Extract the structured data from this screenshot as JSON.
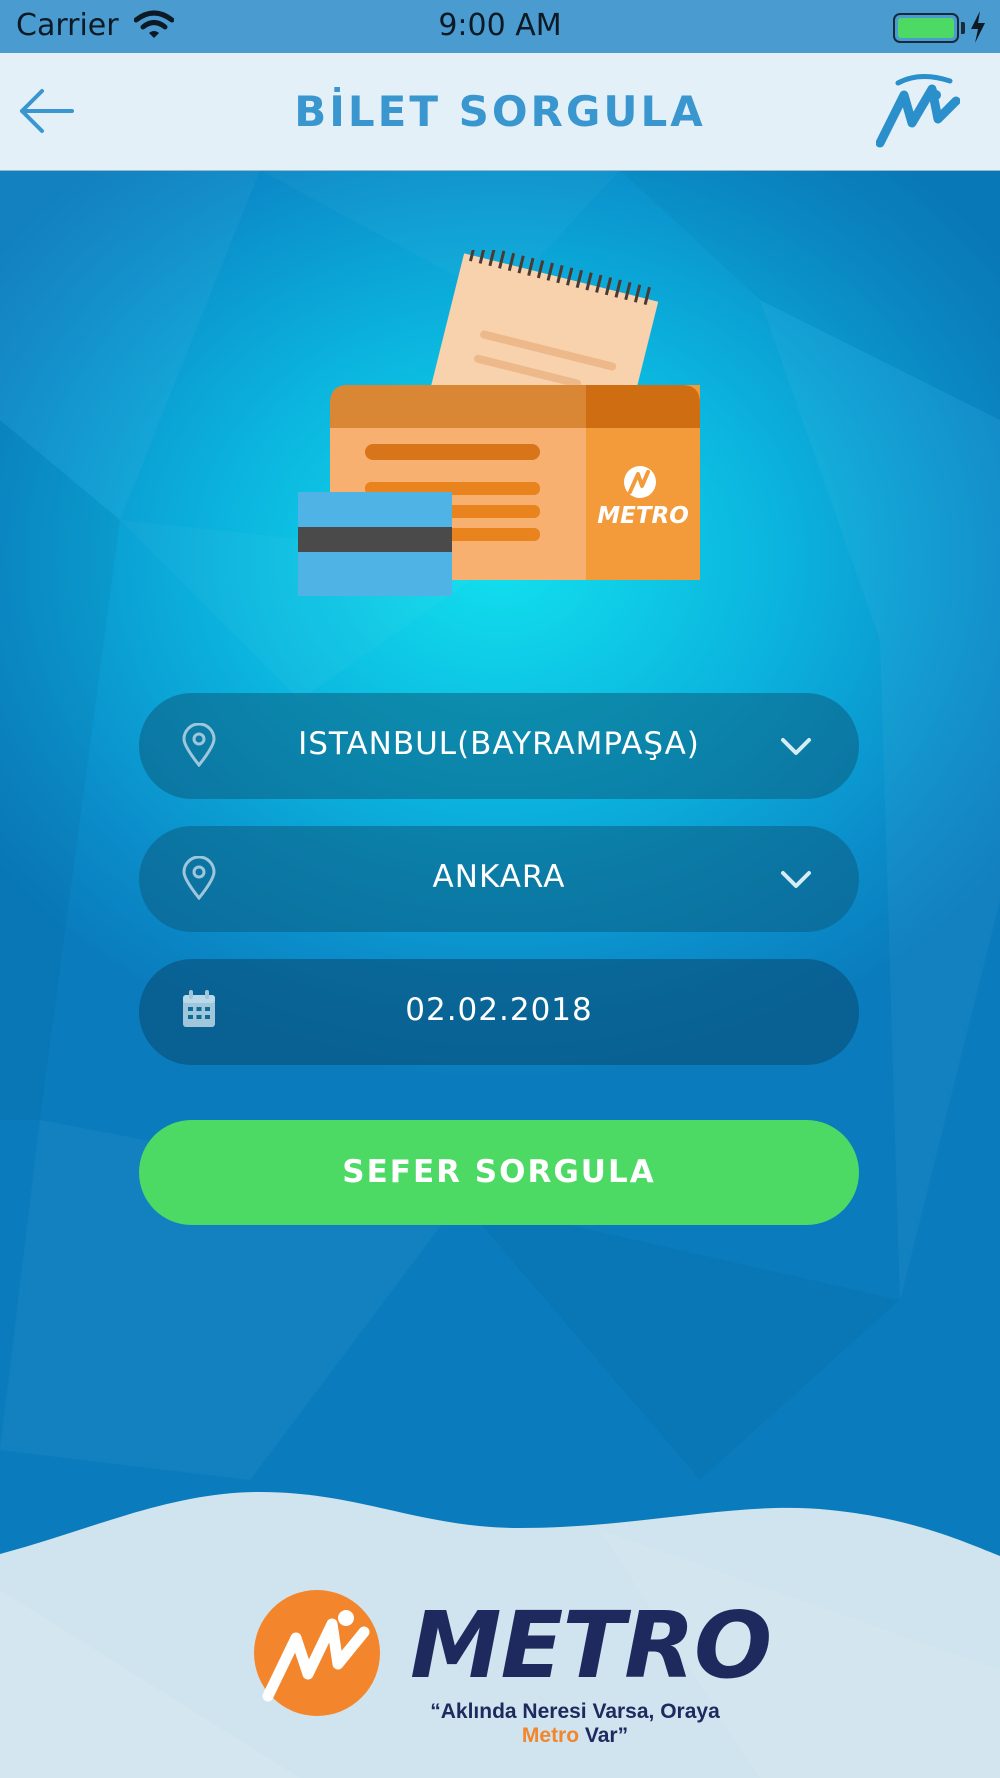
{
  "status_bar": {
    "carrier": "Carrier",
    "time": "9:00 AM",
    "icons": [
      "wifi-icon",
      "battery-icon",
      "charging-bolt-icon"
    ],
    "battery_color": "#4cd964"
  },
  "nav": {
    "title": "BİLET SORGULA",
    "back_icon": "arrow-left-icon",
    "logo_icon": "metro-logo-icon",
    "title_color": "#3a96cf"
  },
  "illustration": {
    "icon": "ticket-and-card-illustration",
    "ticket_brand": "METRO"
  },
  "form": {
    "from": {
      "value": "ISTANBUL(BAYRAMPAŞA)",
      "icon": "location-pin-icon",
      "dropdown_icon": "chevron-down-icon"
    },
    "to": {
      "value": "ANKARA",
      "icon": "location-pin-icon",
      "dropdown_icon": "chevron-down-icon"
    },
    "date": {
      "value": "02.02.2018",
      "icon": "calendar-icon"
    },
    "search_button": "SEFER SORGULA",
    "button_color": "#4cd964"
  },
  "footer": {
    "brand": "METRO",
    "slogan_prefix": "“Aklında Neresi Varsa, Oraya ",
    "slogan_accent": "Metro",
    "slogan_suffix": " Var”",
    "accent_color": "#f3862c",
    "brand_color": "#1e2a5e"
  }
}
